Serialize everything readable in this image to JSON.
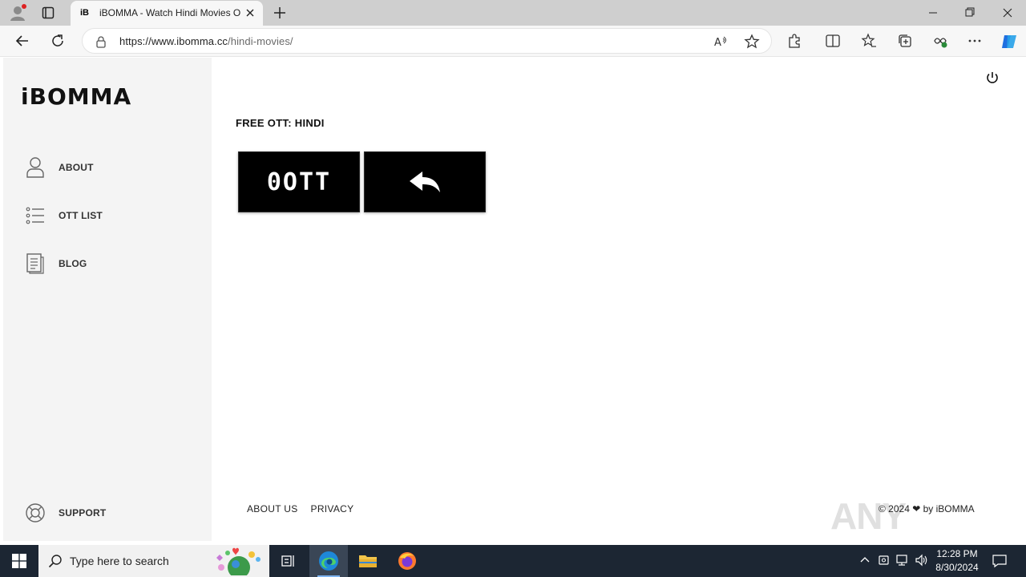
{
  "browser": {
    "tab_title": "iBOMMA - Watch Hindi Movies O",
    "tab_favicon_text": "iB",
    "url_host": "https://www.ibomma.cc",
    "url_path": "/hindi-movies/"
  },
  "sidebar": {
    "logo_text": "iBOMMA",
    "items": [
      {
        "label": "ABOUT",
        "icon": "person-icon"
      },
      {
        "label": "OTT LIST",
        "icon": "list-icon"
      },
      {
        "label": "BLOG",
        "icon": "document-icon"
      }
    ],
    "support_label": "SUPPORT"
  },
  "main": {
    "heading": "FREE OTT: HINDI",
    "ott_button_label": "0OTT",
    "back_button_icon": "reply-arrow-icon"
  },
  "footer": {
    "links": [
      "ABOUT US",
      "PRIVACY"
    ],
    "copyright": "© 2024 ❤ by iBOMMA"
  },
  "watermark": "ANY RUN",
  "taskbar": {
    "search_placeholder": "Type here to search",
    "time": "12:28 PM",
    "date": "8/30/2024"
  }
}
